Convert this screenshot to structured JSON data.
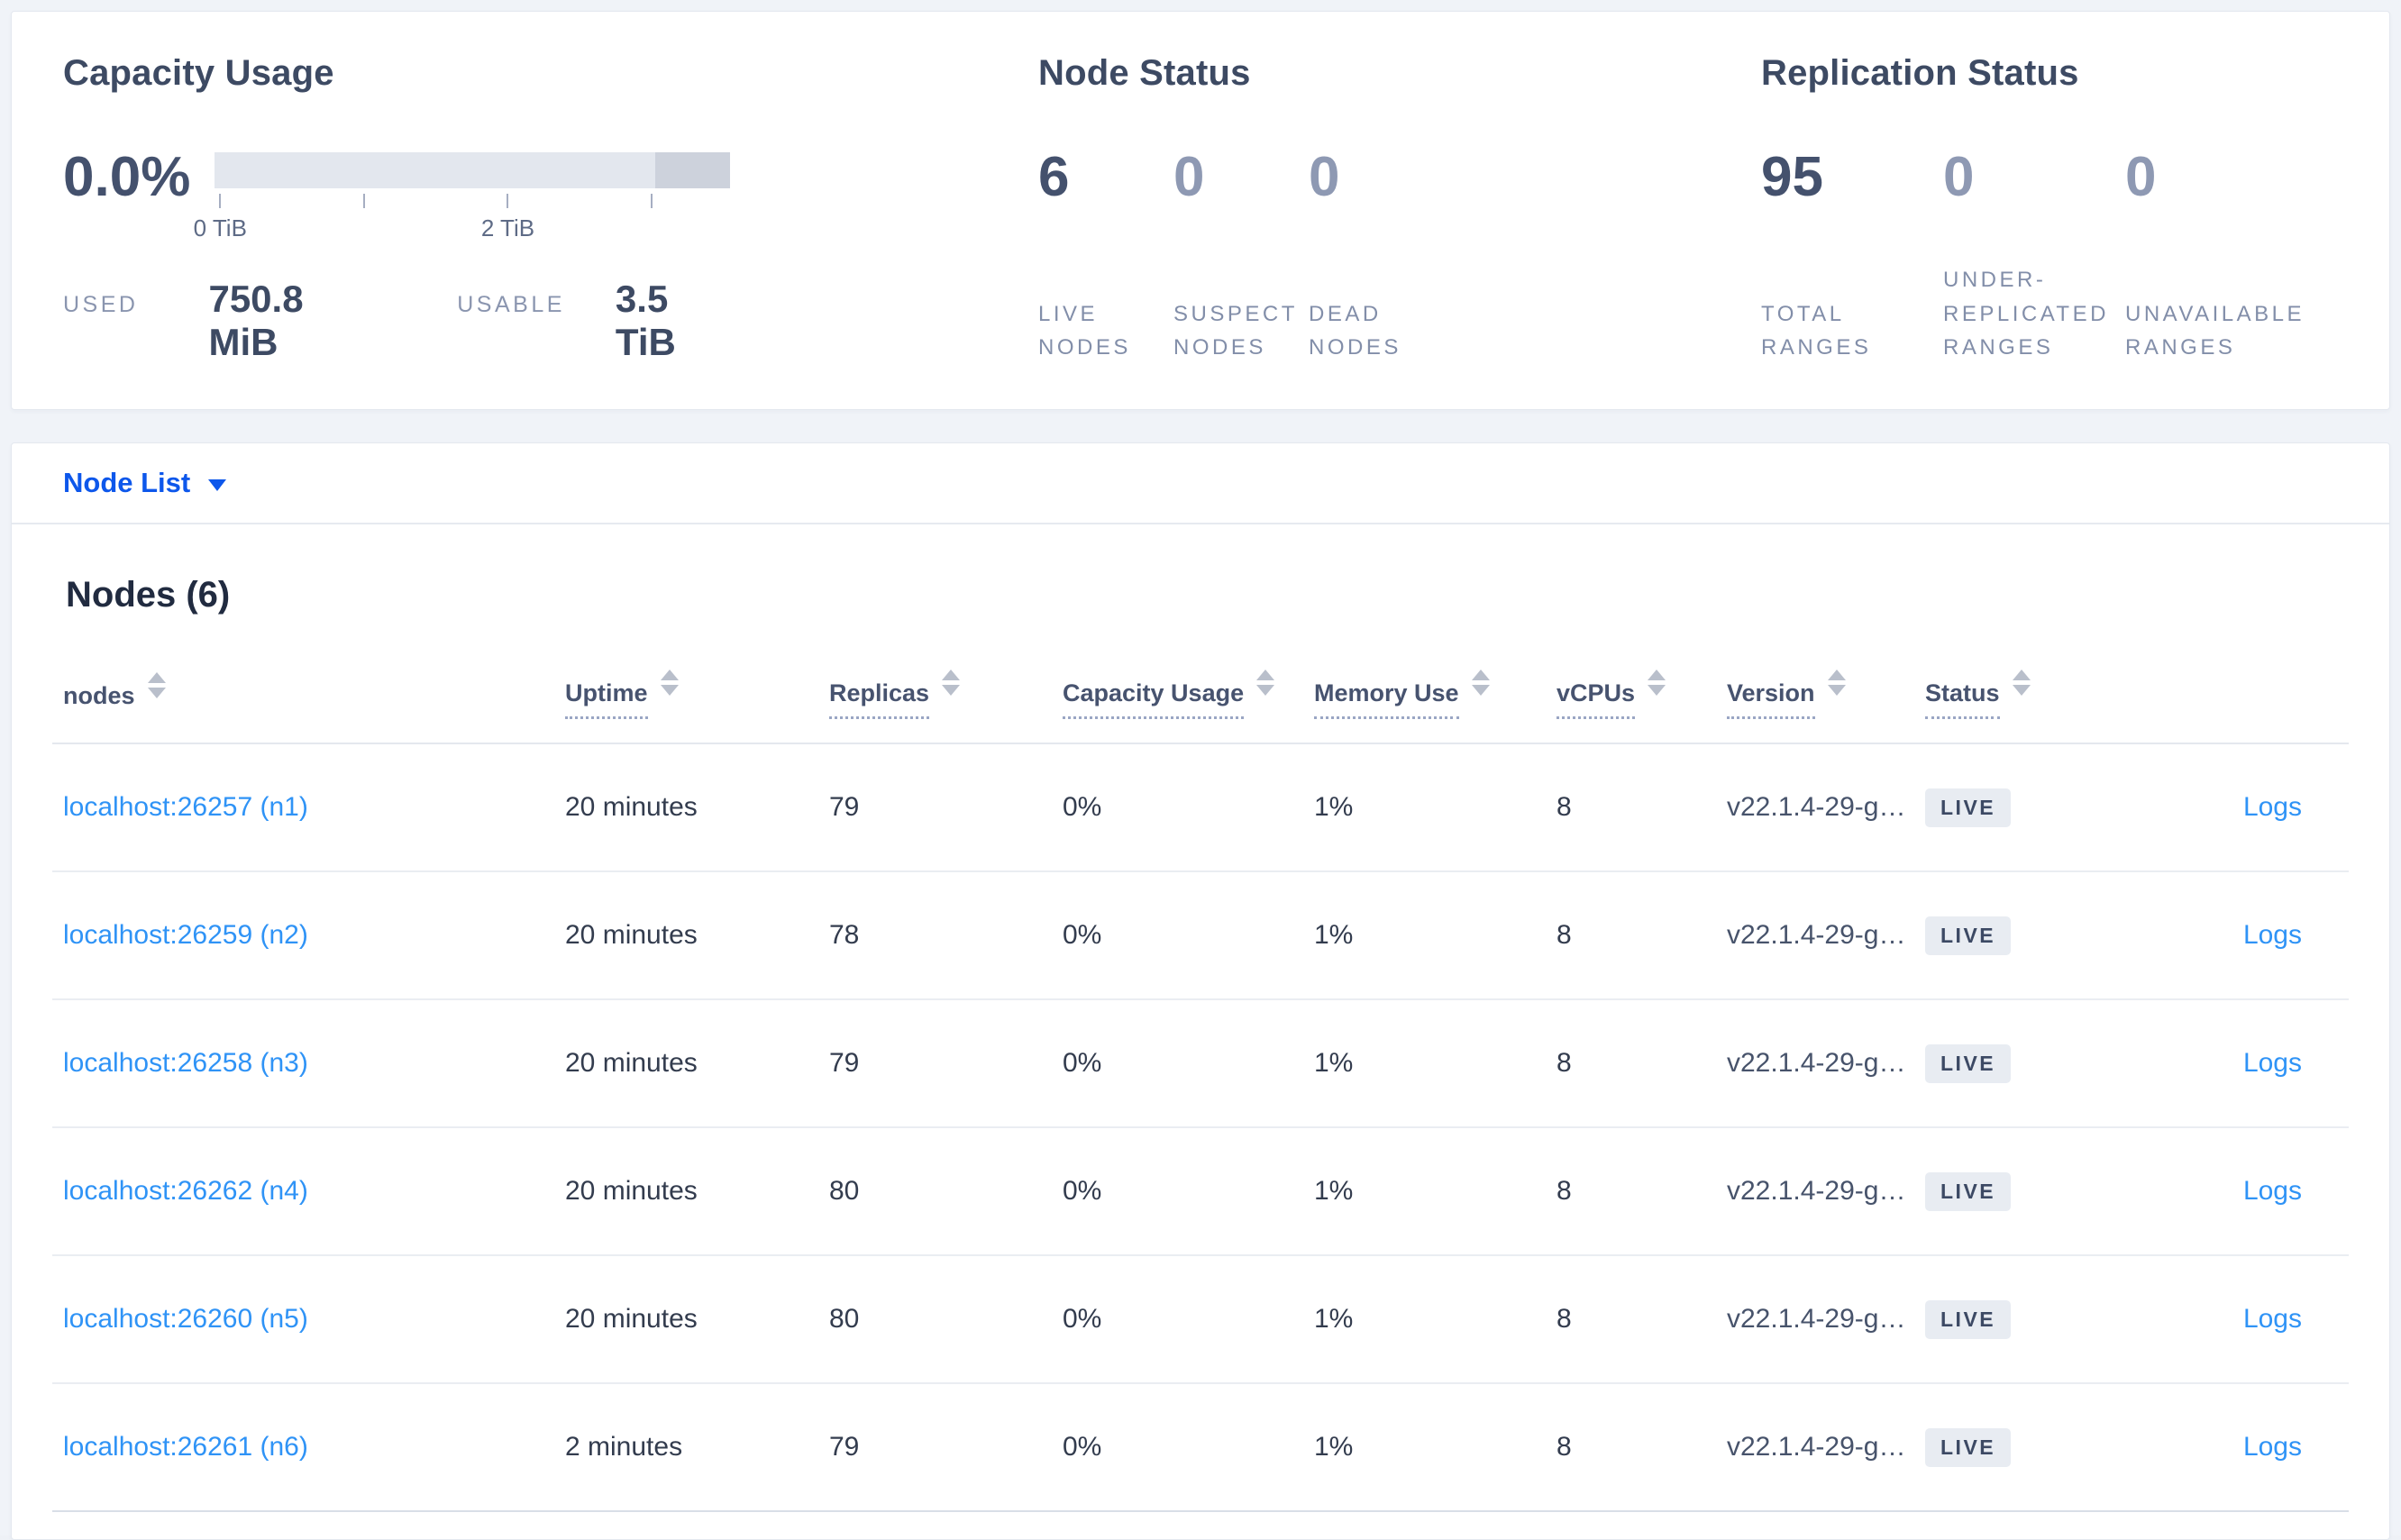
{
  "summary": {
    "capacity": {
      "title": "Capacity Usage",
      "percent": "0.0%",
      "axis_tick_labels": [
        "0 TiB",
        "2 TiB"
      ],
      "axis_range_tib": [
        0,
        3.5
      ],
      "used_label": "USED",
      "used_value": "750.8 MiB",
      "usable_label": "USABLE",
      "usable_value": "3.5 TiB"
    },
    "node_status": {
      "title": "Node Status",
      "stats": [
        {
          "value": "6",
          "label": "LIVE NODES"
        },
        {
          "value": "0",
          "label": "SUSPECT NODES"
        },
        {
          "value": "0",
          "label": "DEAD NODES"
        }
      ]
    },
    "replication_status": {
      "title": "Replication Status",
      "stats": [
        {
          "value": "95",
          "label": "TOTAL RANGES"
        },
        {
          "value": "0",
          "label": "UNDER-REPLICATED RANGES"
        },
        {
          "value": "0",
          "label": "UNAVAILABLE RANGES"
        }
      ]
    }
  },
  "view_selector": {
    "label": "Node List"
  },
  "nodes_section": {
    "title": "Nodes (6)",
    "columns": [
      {
        "label": "nodes"
      },
      {
        "label": "Uptime"
      },
      {
        "label": "Replicas"
      },
      {
        "label": "Capacity Usage"
      },
      {
        "label": "Memory Use"
      },
      {
        "label": "vCPUs"
      },
      {
        "label": "Version"
      },
      {
        "label": "Status"
      }
    ],
    "rows": [
      {
        "node": "localhost:26257 (n1)",
        "uptime": "20 minutes",
        "replicas": "79",
        "capacity": "0%",
        "memory": "1%",
        "vcpus": "8",
        "version": "v22.1.4-29-g…",
        "status": "LIVE",
        "logs": "Logs"
      },
      {
        "node": "localhost:26259 (n2)",
        "uptime": "20 minutes",
        "replicas": "78",
        "capacity": "0%",
        "memory": "1%",
        "vcpus": "8",
        "version": "v22.1.4-29-g…",
        "status": "LIVE",
        "logs": "Logs"
      },
      {
        "node": "localhost:26258 (n3)",
        "uptime": "20 minutes",
        "replicas": "79",
        "capacity": "0%",
        "memory": "1%",
        "vcpus": "8",
        "version": "v22.1.4-29-g…",
        "status": "LIVE",
        "logs": "Logs"
      },
      {
        "node": "localhost:26262 (n4)",
        "uptime": "20 minutes",
        "replicas": "80",
        "capacity": "0%",
        "memory": "1%",
        "vcpus": "8",
        "version": "v22.1.4-29-g…",
        "status": "LIVE",
        "logs": "Logs"
      },
      {
        "node": "localhost:26260 (n5)",
        "uptime": "20 minutes",
        "replicas": "80",
        "capacity": "0%",
        "memory": "1%",
        "vcpus": "8",
        "version": "v22.1.4-29-g…",
        "status": "LIVE",
        "logs": "Logs"
      },
      {
        "node": "localhost:26261 (n6)",
        "uptime": "2 minutes",
        "replicas": "79",
        "capacity": "0%",
        "memory": "1%",
        "vcpus": "8",
        "version": "v22.1.4-29-g…",
        "status": "LIVE",
        "logs": "Logs"
      }
    ]
  },
  "colors": {
    "selector_blue": "#0d57eb",
    "link_blue": "#2f93f6",
    "stat_dark": "#44516d",
    "stat_muted": "#8e99b3",
    "badge_bg": "#e8ecf2",
    "badge_text": "#3c4964",
    "bar_track": "#e3e7ee",
    "bar_segment": "#cdd2dc",
    "page_bg": "#f0f3f8"
  }
}
